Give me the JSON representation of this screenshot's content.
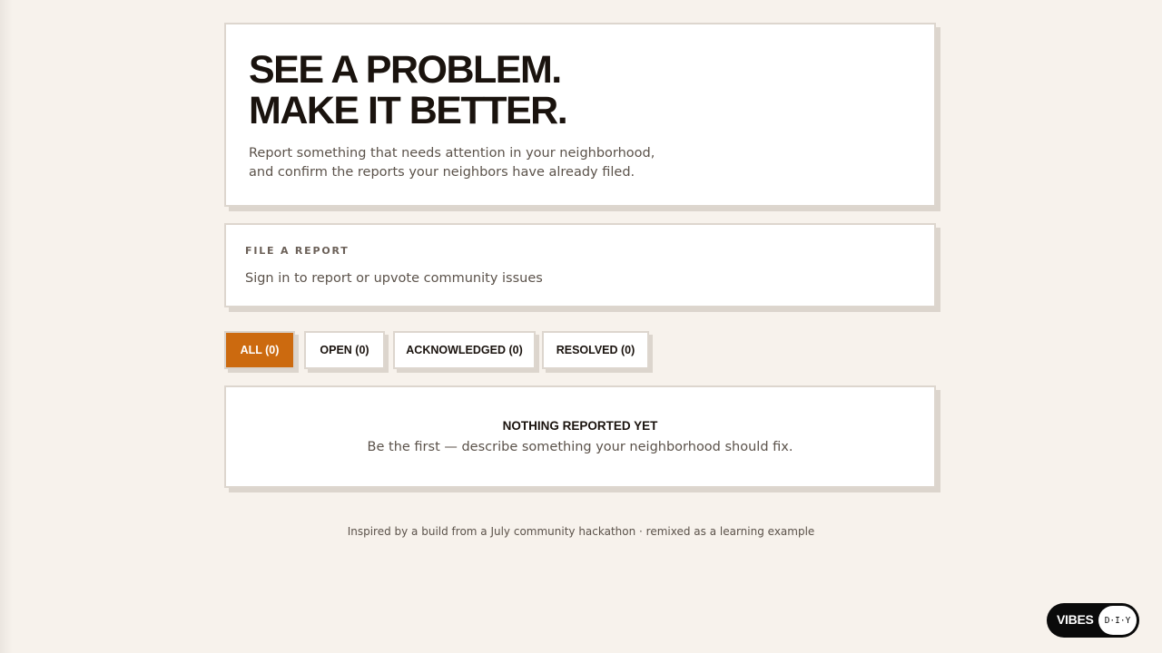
{
  "hero": {
    "title_line1": "SEE A PROBLEM.",
    "title_line2": "MAKE IT BETTER.",
    "subtitle_line1": "Report something that needs attention in your neighborhood,",
    "subtitle_line2": "and confirm the reports your neighbors have already filed."
  },
  "report": {
    "section_label": "FILE A REPORT",
    "signin_text": "Sign in to report or upvote community issues"
  },
  "filters": {
    "selected": "all",
    "all": "ALL (0)",
    "open": "OPEN (0)",
    "acknowledged": "ACKNOWLEDGED (0)",
    "resolved": "RESOLVED (0)"
  },
  "empty_state": {
    "title": "NOTHING REPORTED YET",
    "message": "Be the first — describe something your neighborhood should fix."
  },
  "footer": {
    "text": "Inspired by a build from a July community hackathon · remixed as a learning example"
  },
  "badge": {
    "brand": "VIBES",
    "tag": "D·I·Y"
  },
  "colors": {
    "background": "#f7f2ec",
    "accent": "#cc6a0f",
    "card": "#ffffff",
    "text": "#1a130e",
    "muted_text": "#5b524a"
  }
}
